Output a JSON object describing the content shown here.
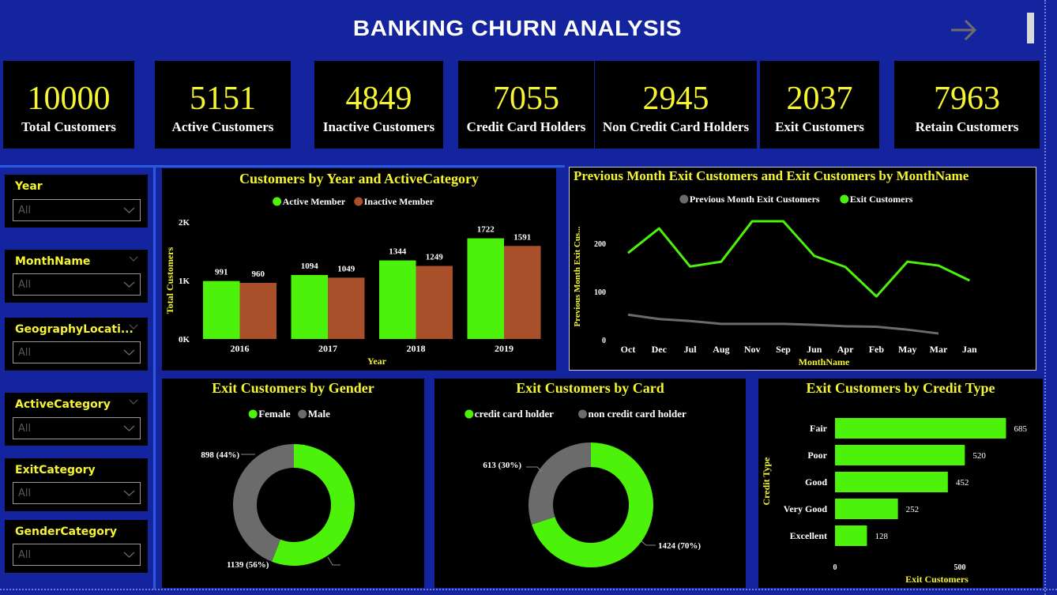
{
  "header": {
    "title": "BANKING CHURN ANALYSIS",
    "nav_icon": "arrow-right-icon",
    "scroll_icon": "scrollbar-thumb"
  },
  "kpis": [
    {
      "value": "10000",
      "label": "Total Customers"
    },
    {
      "value": "5151",
      "label": "Active Customers"
    },
    {
      "value": "4849",
      "label": "Inactive Customers"
    },
    {
      "value": "7055",
      "label": "Credit Card Holders"
    },
    {
      "value": "2945",
      "label": "Non Credit Card Holders"
    },
    {
      "value": "2037",
      "label": "Exit Customers"
    },
    {
      "value": "7963",
      "label": "Retain Customers"
    }
  ],
  "slicers": [
    {
      "title": "Year",
      "value": "All"
    },
    {
      "title": "MonthName",
      "value": "All"
    },
    {
      "title": "GeographyLocati...",
      "value": "All"
    },
    {
      "title": "ActiveCategory",
      "value": "All"
    },
    {
      "title": "ExitCategory",
      "value": "All"
    },
    {
      "title": "GenderCategory",
      "value": "All"
    }
  ],
  "colors": {
    "background": "#13249e",
    "accent_yellow": "#f5f532",
    "green": "#4cf20a",
    "rust": "#a9502a",
    "grey": "#6b6b6b"
  },
  "chart_data": [
    {
      "id": "year_active",
      "type": "bar",
      "title": "Customers by Year and ActiveCategory",
      "xlabel": "Year",
      "ylabel": "Total Customers",
      "categories": [
        "2016",
        "2017",
        "2018",
        "2019"
      ],
      "series": [
        {
          "name": "Active Member",
          "color": "#4cf20a",
          "values": [
            991,
            1094,
            1344,
            1722
          ]
        },
        {
          "name": "Inactive Member",
          "color": "#a9502a",
          "values": [
            960,
            1049,
            1249,
            1591
          ]
        }
      ],
      "ylim": [
        0,
        2000
      ],
      "yticks": [
        {
          "v": 0,
          "label": "0K"
        },
        {
          "v": 1000,
          "label": "1K"
        },
        {
          "v": 2000,
          "label": "2K"
        }
      ],
      "legend": "top-center",
      "grid": false
    },
    {
      "id": "month_exit",
      "type": "line",
      "title": "Previous Month Exit Customers and Exit Customers by MonthName",
      "xlabel": "MonthName",
      "ylabel": "Previous Month Exit Cus...",
      "categories": [
        "Oct",
        "Dec",
        "Jul",
        "Aug",
        "Nov",
        "Sep",
        "Jun",
        "Apr",
        "Feb",
        "May",
        "Mar",
        "Jan"
      ],
      "series": [
        {
          "name": "Previous Month Exit Customers",
          "color": "#6b6b6b",
          "values": [
            52,
            43,
            39,
            33,
            33,
            33,
            31,
            28,
            27,
            21,
            13,
            null
          ]
        },
        {
          "name": "Exit Customers",
          "color": "#4cf20a",
          "values": [
            180,
            231,
            152,
            162,
            246,
            246,
            174,
            151,
            90,
            162,
            154,
            123
          ]
        }
      ],
      "ylim": [
        0,
        250
      ],
      "yticks": [
        0,
        100,
        200
      ],
      "legend": "top-center",
      "grid": false
    },
    {
      "id": "gender",
      "type": "pie",
      "donut": true,
      "title": "Exit Customers by Gender",
      "slices": [
        {
          "name": "Female",
          "value": 1139,
          "pct": "56%",
          "label": "1139 (56%)",
          "color": "#4cf20a"
        },
        {
          "name": "Male",
          "value": 898,
          "pct": "44%",
          "label": "898 (44%)",
          "color": "#6b6b6b"
        }
      ],
      "legend": "top-center"
    },
    {
      "id": "card",
      "type": "pie",
      "donut": true,
      "title": "Exit Customers by Card",
      "slices": [
        {
          "name": "credit card holder",
          "value": 1424,
          "pct": "70%",
          "label": "1424 (70%)",
          "color": "#4cf20a"
        },
        {
          "name": "non credit card holder",
          "value": 613,
          "pct": "30%",
          "label": "613 (30%)",
          "color": "#6b6b6b"
        }
      ],
      "legend": "top-center"
    },
    {
      "id": "credit_type",
      "type": "bar",
      "orientation": "horizontal",
      "title": "Exit Customers by Credit Type",
      "xlabel": "Exit Customers",
      "ylabel": "Credit Type",
      "categories": [
        "Fair",
        "Poor",
        "Good",
        "Very Good",
        "Excellent"
      ],
      "values": [
        685,
        520,
        452,
        252,
        128
      ],
      "color": "#4cf20a",
      "xlim": [
        0,
        700
      ],
      "xticks": [
        0,
        500
      ],
      "grid": false
    }
  ]
}
